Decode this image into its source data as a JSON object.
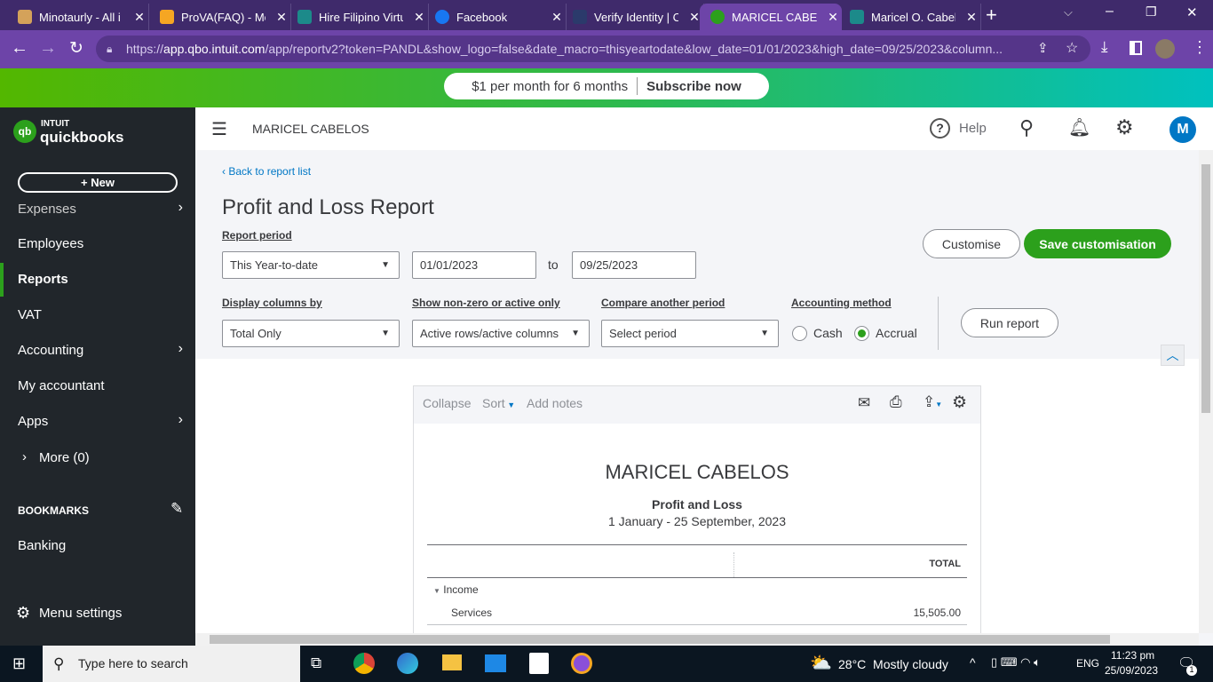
{
  "browser": {
    "tabs": [
      {
        "title": "Minotaurly - All i",
        "color": "#d4a25a"
      },
      {
        "title": "ProVA(FAQ) - Me",
        "color": "#f5a623"
      },
      {
        "title": "Hire Filipino Virtu",
        "color": "#1c8a8a"
      },
      {
        "title": "Facebook",
        "color": "#1877f2"
      },
      {
        "title": "Verify Identity | C",
        "color": "#2b3a6b"
      },
      {
        "title": "MARICEL CABELO",
        "color": "#2ca01c"
      },
      {
        "title": "Maricel O. Cabel",
        "color": "#1c8a8a"
      }
    ],
    "new_tab": "+",
    "url_prefix": "https://",
    "url_host": "app.qbo.intuit.com",
    "url_rest": "/app/reportv2?token=PANDL&show_logo=false&date_macro=thisyeartodate&low_date=01/01/2023&high_date=09/25/2023&column..."
  },
  "promo": {
    "text": "$1 per month for 6 months",
    "cta": "Subscribe now"
  },
  "sidebar": {
    "logo_top": "INTUIT",
    "logo_bottom": "quickbooks",
    "new_button": "+ New",
    "items": [
      {
        "label": "Expenses"
      },
      {
        "label": "Employees"
      },
      {
        "label": "Reports"
      },
      {
        "label": "VAT"
      },
      {
        "label": "Accounting"
      },
      {
        "label": "My accountant"
      },
      {
        "label": "Apps"
      },
      {
        "label": "More (0)"
      }
    ],
    "bookmarks": "BOOKMARKS",
    "banking": "Banking",
    "menu_settings": "Menu settings"
  },
  "topbar": {
    "company": "MARICEL CABELOS",
    "help": "Help",
    "avatar": "M"
  },
  "page": {
    "back": "Back to report list",
    "title": "Profit and Loss Report",
    "report_period_label": "Report period",
    "report_period": "This Year-to-date",
    "from": "01/01/2023",
    "to_label": "to",
    "to": "09/25/2023",
    "customise": "Customise",
    "save": "Save customisation",
    "display_label": "Display columns by",
    "display": "Total Only",
    "nonzero_label": "Show non-zero or active only",
    "nonzero": "Active rows/active columns",
    "compare_label": "Compare another period",
    "compare": "Select period",
    "method_label": "Accounting method",
    "cash": "Cash",
    "accrual": "Accrual",
    "run": "Run report"
  },
  "report": {
    "collapse": "Collapse",
    "sort": "Sort",
    "notes": "Add notes",
    "company": "MARICEL CABELOS",
    "title": "Profit and Loss",
    "range": "1 January - 25 September, 2023",
    "col_total": "TOTAL",
    "income": "Income",
    "services": "Services",
    "services_total": "15,505.00"
  },
  "taskbar": {
    "search": "Type here to search",
    "weather": "28°C  Mostly cloudy",
    "lang": "ENG",
    "time": "11:23 pm",
    "date": "25/09/2023",
    "notif": "1"
  }
}
